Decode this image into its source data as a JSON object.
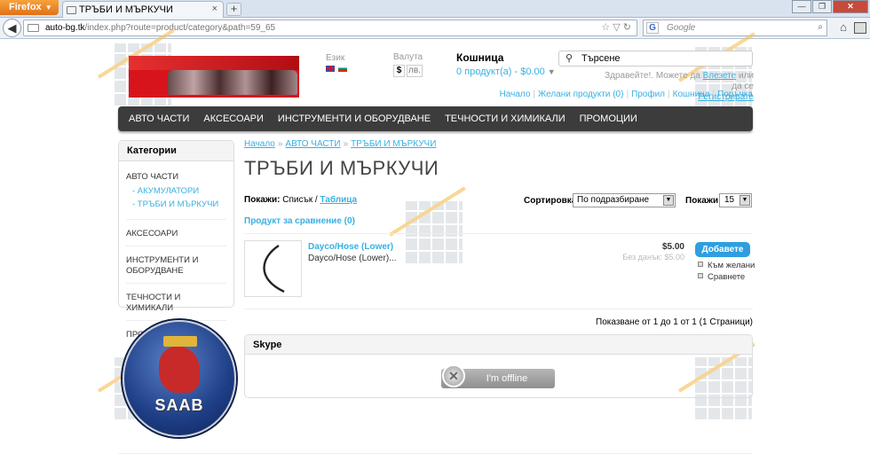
{
  "browser": {
    "menu_button": "Firefox",
    "tab_title": "ТРЪБИ И МЪРКУЧИ",
    "new_tab": "+",
    "url_host": "auto-bg.tk",
    "url_path": "/index.php?route=product/category&path=59_65",
    "search_engine_placeholder": "Google",
    "search_engine_logo": "G"
  },
  "header": {
    "language_label": "Език",
    "currency_label": "Валута",
    "currency_options": [
      "$",
      "лв."
    ],
    "cart_title": "Кошница",
    "cart_value": "0 продукт(а) - $0.00",
    "search_placeholder": "Търсене",
    "welcome_text": "Здравейте!. Можете да",
    "login_link": "Влезете",
    "welcome_or": "или да се",
    "register_link": "Регистрирате",
    "links": [
      "Начало",
      "Желани продукти (0)",
      "Профил",
      "Кошница",
      "Поръчка"
    ]
  },
  "menu": [
    "АВТО ЧАСТИ",
    "АКСЕСОАРИ",
    "ИНСТРУМЕНТИ И ОБОРУДВАНЕ",
    "ТЕЧНОСТИ И ХИМИКАЛИ",
    "ПРОМОЦИИ"
  ],
  "categories": {
    "title": "Категории",
    "top": "АВТО ЧАСТИ",
    "subs": [
      "- АКУМУЛАТОРИ",
      "- ТРЪБИ И МЪРКУЧИ"
    ],
    "others": [
      "АКСЕСОАРИ",
      "ИНСТРУМЕНТИ И ОБОРУДВАНЕ",
      "ТЕЧНОСТИ И ХИМИКАЛИ",
      "ПРОМОЦИИ"
    ]
  },
  "brand_logo_text": "SAAB",
  "breadcrumb": [
    "Начало",
    "АВТО ЧАСТИ",
    "ТРЪБИ И МЪРКУЧИ"
  ],
  "breadcrumb_sep": "»",
  "heading": "ТРЪБИ И МЪРКУЧИ",
  "toolbar": {
    "display_label": "Покажи:",
    "display_list": "Списък /",
    "display_grid": "Таблица",
    "sort_label": "Сортировка:",
    "sort_value": "По подразбиране",
    "limit_label": "Покажи:",
    "limit_value": "15"
  },
  "compare_link": "Продукт за сравнение (0)",
  "product": {
    "name": "Dayco/Hose (Lower)",
    "desc": "Dayco/Hose (Lower)...",
    "price": "$5.00",
    "price_ex_tax": "Без данък: $5.00",
    "add_button": "Добавете",
    "wishlist": "Към желани",
    "compare": "Сравнете"
  },
  "pagination": "Показване от 1 до 1 от 1 (1 Страници)",
  "skype": {
    "title": "Skype",
    "status": "I'm offline"
  }
}
